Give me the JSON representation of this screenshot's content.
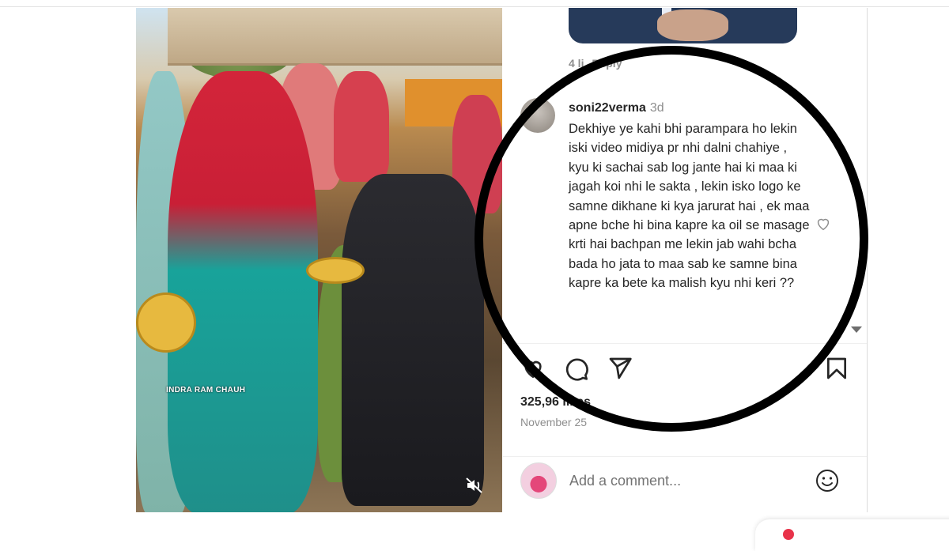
{
  "post": {
    "watermark": "INDRA RAM CHAUH",
    "mute_icon": "speaker-muted-icon"
  },
  "previous_comment": {
    "likes": "4 li",
    "reply": "Reply"
  },
  "comment": {
    "username": "soni22verma",
    "age": "3d",
    "text": "Dekhiye ye kahi bhi parampara ho lekin iski video midiya pr nhi dalni chahiye , kyu ki sachai sab log jante hai ki maa ki jagah koi nhi le sakta , lekin isko logo ke samne dikhane ki kya jarurat hai , ek maa apne bche hi bina kapre ka oil se masage krti hai bachpan me lekin jab wahi bcha bada ho jata to maa sab ke samne bina kapre ka bete ka malish kyu nhi keri ??",
    "heart_icon": "heart-outline-icon"
  },
  "actions": {
    "like_icon": "heart-icon",
    "comment_icon": "comment-icon",
    "share_icon": "share-icon",
    "save_icon": "bookmark-icon"
  },
  "stats": {
    "likes": "325,96 likes",
    "date": "November 25"
  },
  "add_comment": {
    "placeholder": "Add a comment...",
    "emoji_icon": "emoji-icon"
  },
  "colors": {
    "ring": "#000000",
    "text": "#262626",
    "muted": "#8e8e8e"
  }
}
